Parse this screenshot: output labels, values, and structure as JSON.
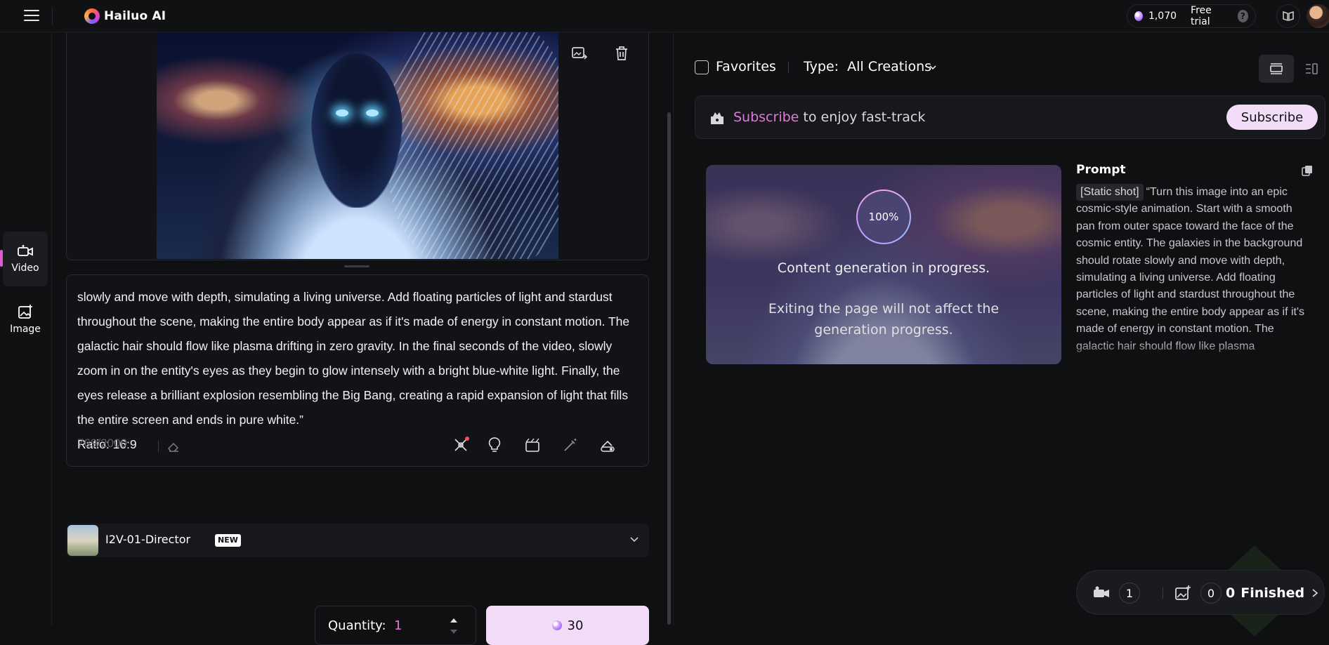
{
  "header": {
    "brand": "Hailuo AI",
    "credits": "1,070",
    "free_trial": "Free trial",
    "help": "?"
  },
  "rail": {
    "items": [
      {
        "label": "Video"
      },
      {
        "label": "Image"
      }
    ]
  },
  "prompt_editor": {
    "text": "slowly and move with depth, simulating a living universe. Add floating particles of light and stardust throughout the scene, making the entire body appear as if it's made of energy in constant motion. The galactic hair should flow like plasma drifting in zero gravity. In the final seconds of the video, slowly zoom in on the entity's eyes as they begin to glow intensely with a bright blue-white light. Finally, the eyes release a brilliant explosion resembling the Big Bang, creating a rapid expansion of light that fills the entire screen and ends in pure white.”",
    "ratio": "Ratio: 16:9",
    "char_count": "769/2000"
  },
  "model": {
    "name": "I2V-01-Director",
    "badge": "NEW"
  },
  "quantity": {
    "label": "Quantity:",
    "value": "1"
  },
  "generate": {
    "cost": "30"
  },
  "filters": {
    "favorites": "Favorites",
    "type_label": "Type:",
    "type_value": "All Creations"
  },
  "subscribe_bar": {
    "highlight": "Subscribe",
    "rest": " to enjoy fast-track",
    "button": "Subscribe"
  },
  "generation": {
    "progress": "100%",
    "status": "Content generation in progress.",
    "note": "Exiting the page will not affect the generation progress."
  },
  "prompt_panel": {
    "title": "Prompt",
    "tag": "[Static shot]",
    "text": "“Turn this image into an epic cosmic-style animation. Start with a smooth pan from outer space toward the face of the cosmic entity. The galaxies in the background should rotate slowly and move with depth, simulating a living universe. Add floating particles of light and stardust throughout the scene, making the entire body appear as if it's made of energy in constant motion. The galactic hair should flow like plasma"
  },
  "queue": {
    "video_count": "1",
    "image_count": "0",
    "finished_count": "0",
    "finished_label": "Finished"
  },
  "colors": {
    "accent": "#e07ad8",
    "button_bg": "#f3dcf7",
    "background": "#0f1012"
  }
}
